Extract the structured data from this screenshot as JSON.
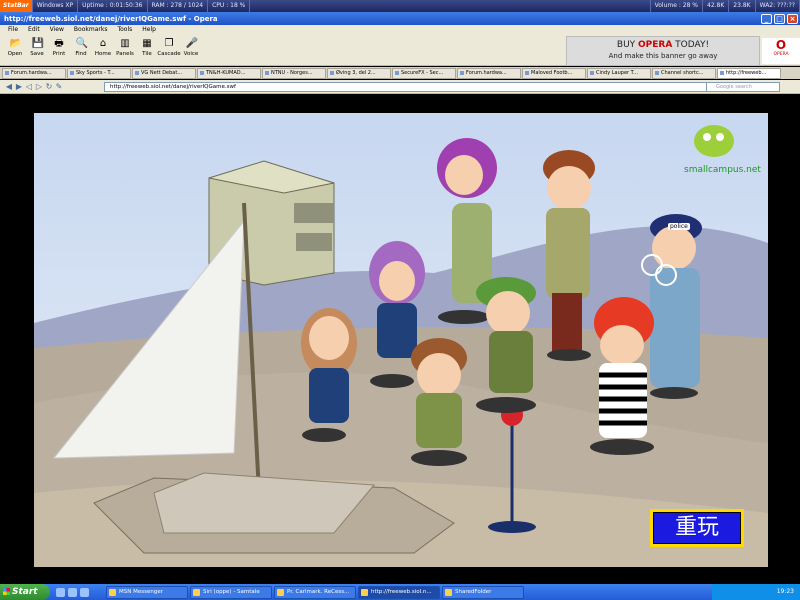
{
  "statbar": {
    "logo": "StatBar",
    "items": [
      "Windows XP",
      "Uptime : 0:01:50:36",
      "RAM : 278 / 1024",
      "CPU : 18 %",
      "Volume : 28 %",
      "42.8K",
      "23.8K",
      "WA2: ???:??"
    ]
  },
  "window": {
    "title": "http://freeweb.siol.net/danej/riverIQGame.swf - Opera"
  },
  "menu": [
    "File",
    "Edit",
    "View",
    "Bookmarks",
    "Tools",
    "Help"
  ],
  "toolbar": [
    {
      "label": "Open",
      "icon": "folder-icon"
    },
    {
      "label": "Save",
      "icon": "save-icon"
    },
    {
      "label": "Print",
      "icon": "print-icon"
    },
    {
      "label": "Find",
      "icon": "find-icon"
    },
    {
      "label": "Home",
      "icon": "home-icon"
    },
    {
      "label": "Panels",
      "icon": "panels-icon"
    },
    {
      "label": "Tile",
      "icon": "tile-icon"
    },
    {
      "label": "Cascade",
      "icon": "cascade-icon"
    },
    {
      "label": "Voice",
      "icon": "voice-icon"
    }
  ],
  "banner": {
    "line1_pre": "BUY ",
    "line1_brand": "OPERA",
    "line1_post": " TODAY!",
    "line2": "And make this banner go away",
    "opera_logo": "O",
    "opera_text": "OPERA"
  },
  "tabs": [
    "Forum.hardwa...",
    "Sky Sports - T...",
    "VG Nett Debat...",
    "TN&H-KUMAD...",
    "NTNU - Norges...",
    "Øving 3, del 2...",
    "SecureFX - Sec...",
    "Forum.hardwa...",
    "Maloved Footb...",
    "Cindy Lauper T...",
    "Channel shortc...",
    "http://freeweb..."
  ],
  "address": {
    "url": "http://freeweb.siol.net/danej/riverIQGame.swf",
    "search_placeholder": "Google search"
  },
  "game": {
    "brand": "smallcampus.net",
    "police_label": "police",
    "replay_label": "重玩"
  },
  "taskbar": {
    "start_label": "Start",
    "tasks": [
      "MSN Messenger",
      "Siri (oppe) - Samtale",
      "Pr. Carlmark. ReCess...",
      "http://freeweb.siol.n...",
      "SharedFolder"
    ],
    "clock": "19:23"
  }
}
